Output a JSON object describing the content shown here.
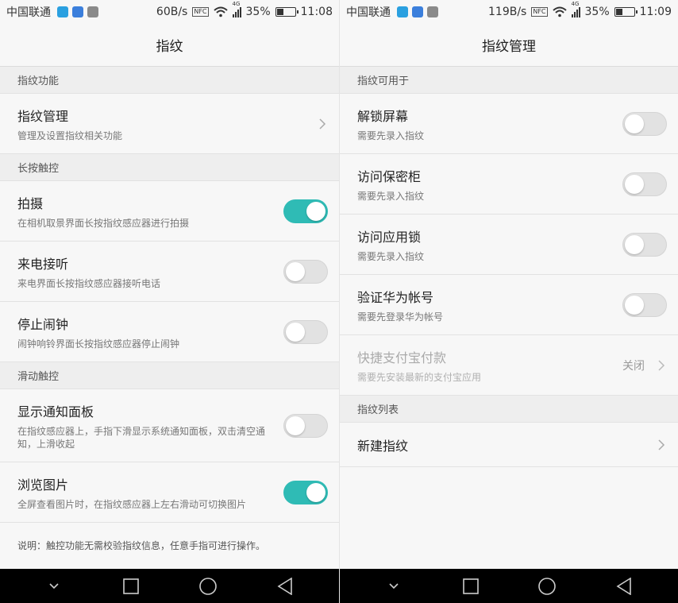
{
  "left": {
    "status": {
      "carrier": "中国联通",
      "speed": "60B/s",
      "nfc": "NFC",
      "network": "4G",
      "battery": "35%",
      "time": "11:08"
    },
    "title": "指纹",
    "sections": {
      "s1": "指纹功能",
      "s2": "长按触控",
      "s3": "滑动触控"
    },
    "rows": {
      "manage": {
        "title": "指纹管理",
        "sub": "管理及设置指纹相关功能"
      },
      "shoot": {
        "title": "拍摄",
        "sub": "在相机取景界面长按指纹感应器进行拍摄"
      },
      "answer": {
        "title": "来电接听",
        "sub": "来电界面长按指纹感应器接听电话"
      },
      "alarm": {
        "title": "停止闹钟",
        "sub": "闹钟响铃界面长按指纹感应器停止闹钟"
      },
      "notify": {
        "title": "显示通知面板",
        "sub": "在指纹感应器上，手指下滑显示系统通知面板，双击清空通知，上滑收起"
      },
      "browse": {
        "title": "浏览图片",
        "sub": "全屏查看图片时，在指纹感应器上左右滑动可切换图片"
      }
    },
    "note": "说明：触控功能无需校验指纹信息，任意手指可进行操作。"
  },
  "right": {
    "status": {
      "carrier": "中国联通",
      "speed": "119B/s",
      "nfc": "NFC",
      "network": "4G",
      "battery": "35%",
      "time": "11:09"
    },
    "title": "指纹管理",
    "sections": {
      "s1": "指纹可用于",
      "s2": "指纹列表"
    },
    "rows": {
      "unlock": {
        "title": "解锁屏幕",
        "sub": "需要先录入指纹"
      },
      "safe": {
        "title": "访问保密柜",
        "sub": "需要先录入指纹"
      },
      "applock": {
        "title": "访问应用锁",
        "sub": "需要先录入指纹"
      },
      "huawei": {
        "title": "验证华为帐号",
        "sub": "需要先登录华为帐号"
      },
      "alipay": {
        "title": "快捷支付宝付款",
        "sub": "需要先安装最新的支付宝应用",
        "value": "关闭"
      },
      "new": {
        "title": "新建指纹"
      }
    }
  },
  "toggles": {
    "shoot": true,
    "answer": false,
    "alarm": false,
    "notify": false,
    "browse": true,
    "unlock": false,
    "safe": false,
    "applock": false,
    "huawei": false
  },
  "colors": {
    "accent": "#2fbbb5",
    "navbar": "#000000"
  },
  "icons": [
    "location-icon",
    "health-icon",
    "gallery-icon",
    "wifi-icon",
    "signal-icon",
    "battery-icon",
    "chevron-right-icon",
    "back-down-icon",
    "recents-icon",
    "home-icon",
    "back-icon"
  ]
}
